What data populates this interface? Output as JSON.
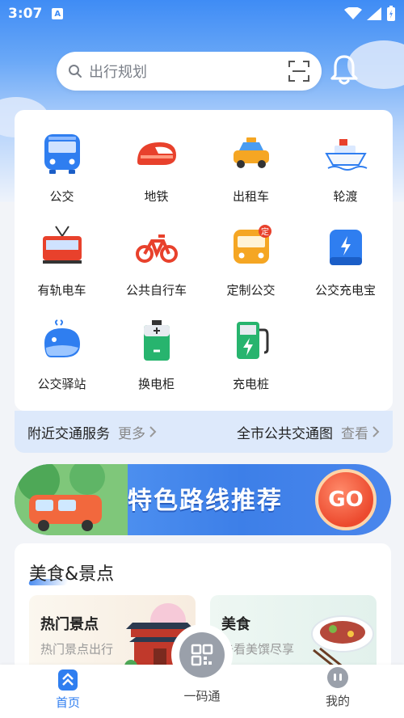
{
  "status_bar": {
    "time": "3:07",
    "notification_glyph": "A"
  },
  "search": {
    "placeholder": "出行规划"
  },
  "services": [
    {
      "label": "公交",
      "icon": "bus-icon"
    },
    {
      "label": "地铁",
      "icon": "metro-icon"
    },
    {
      "label": "出租车",
      "icon": "taxi-icon"
    },
    {
      "label": "轮渡",
      "icon": "ferry-icon"
    },
    {
      "label": "有轨电车",
      "icon": "tram-icon"
    },
    {
      "label": "公共自行车",
      "icon": "bicycle-icon"
    },
    {
      "label": "定制公交",
      "icon": "custom-bus-icon",
      "badge": "定"
    },
    {
      "label": "公交充电宝",
      "icon": "power-bank-icon"
    },
    {
      "label": "公交驿站",
      "icon": "whale-station-icon"
    },
    {
      "label": "换电柜",
      "icon": "battery-cabinet-icon"
    },
    {
      "label": "充电桩",
      "icon": "charging-pile-icon"
    }
  ],
  "nearby": {
    "label": "附近交通服务",
    "more": "更多",
    "map_label": "全市公共交通图",
    "map_action": "查看"
  },
  "banner": {
    "text": "特色路线推荐",
    "go": "GO"
  },
  "food_section": {
    "title": "美食&景点",
    "tiles": [
      {
        "title": "热门景点",
        "subtitle": "热门景点出行"
      },
      {
        "title": "美食",
        "subtitle": "去看美馔尽享"
      }
    ]
  },
  "bottom_nav": [
    {
      "label": "首页",
      "active": true
    },
    {
      "label": "一码通",
      "active": false
    },
    {
      "label": "我的",
      "active": false
    }
  ],
  "colors": {
    "accent": "#2f7ef0",
    "nav_inactive": "#444444"
  }
}
